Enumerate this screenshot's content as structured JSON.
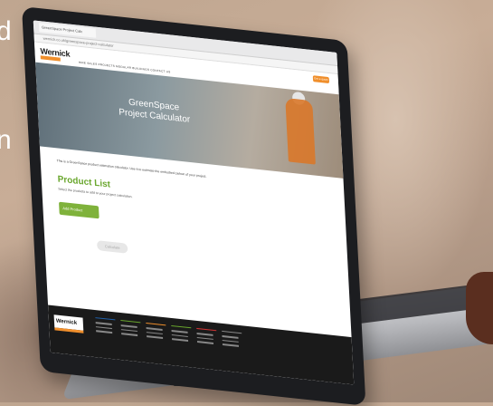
{
  "overlay": {
    "line1": "d",
    "line2": "n"
  },
  "browser": {
    "tab_title": "GreenSpace Project Calc",
    "url": "wernick.co.uk/greenspace-project-calculator"
  },
  "site": {
    "logo": "Wernick",
    "cta": "Get a quote",
    "nav": "HIRE   SALES   PROJECTS   MODULAR BUILDINGS   CONTACT US",
    "hero_title_line1": "GreenSpace",
    "hero_title_line2": "Project Calculator",
    "intro": "This is a GreenSpace product estimation calculator. Use it to estimate the embodied carbon of your project.",
    "product_title": "Product List",
    "product_sub": "Select the products to add to your project calculation.",
    "add_button": "Add Product",
    "calc_button": "Calculate"
  },
  "footer": {
    "logo": "Wernick"
  },
  "colors": {
    "accent_orange": "#f08f2c",
    "accent_green": "#7fb23b",
    "title_green": "#6aa72e"
  }
}
